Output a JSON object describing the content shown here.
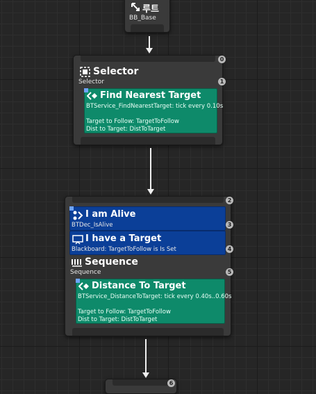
{
  "root_node": {
    "title": "루트",
    "subtitle": "BB_Base",
    "icon": "root-arrow-icon"
  },
  "selector_node": {
    "title": "Selector",
    "subtitle": "Selector",
    "index_top": "0",
    "index_side": "1",
    "icon": "selector-icon",
    "service": {
      "title": "Find Nearest Target",
      "line1": "BTService_FindNearestTarget: tick every 0.10s",
      "line2": "Target to Follow: TargetToFollow",
      "line3": "Dist to Target: DistToTarget",
      "icon": "service-icon"
    }
  },
  "sequence_node": {
    "index_top": "2",
    "decorators": [
      {
        "title": "I am Alive",
        "subtitle": "BTDec_IsAlive",
        "index": "3",
        "icon": "decorator-icon"
      },
      {
        "title": "I have a Target",
        "subtitle": "Blackboard: TargetToFollow is Is Set",
        "index": "4",
        "icon": "blackboard-icon"
      }
    ],
    "title": "Sequence",
    "subtitle": "Sequence",
    "index": "5",
    "icon": "sequence-icon",
    "service": {
      "title": "Distance To Target",
      "line1": "BTService_DistanceToTarget: tick every 0.40s..0.60s",
      "line2": "Target to Follow: TargetToFollow",
      "line3": "Dist to Target: DistToTarget",
      "icon": "service-icon"
    }
  },
  "bottom_node": {
    "index": "6"
  },
  "colors": {
    "service_green": "#0e8a6a",
    "decorator_blue": "#0b3f98",
    "node_gray": "#3a3a3a",
    "wire_white": "#f0f0f0"
  }
}
